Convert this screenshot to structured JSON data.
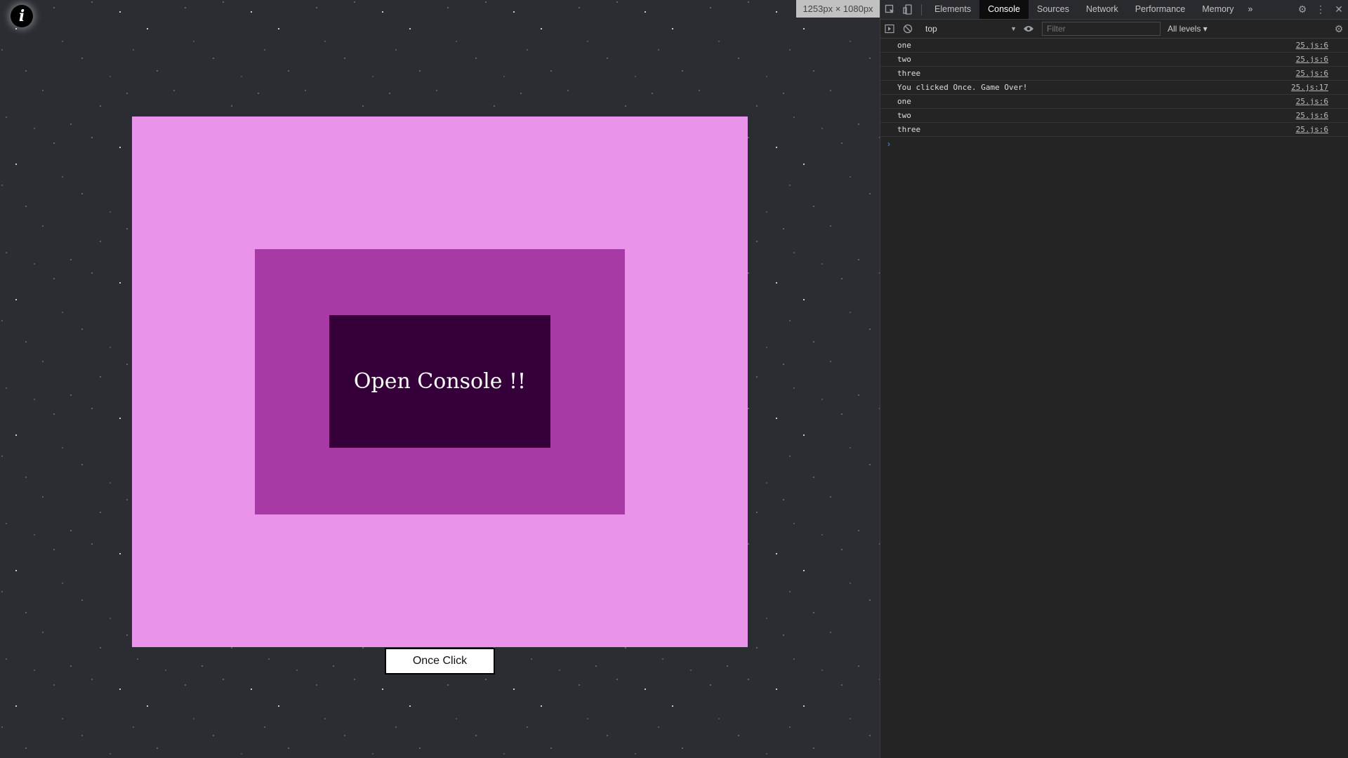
{
  "page": {
    "info_icon": "i",
    "size_badge": "1253px × 1080px",
    "heading": "Open Console !!",
    "button_label": "Once Click",
    "colors": {
      "outer": "#e994ea",
      "middle": "#a83aa5",
      "inner": "#35003a"
    }
  },
  "devtools": {
    "tabs": [
      {
        "label": "Elements",
        "active": false
      },
      {
        "label": "Console",
        "active": true
      },
      {
        "label": "Sources",
        "active": false
      },
      {
        "label": "Network",
        "active": false
      },
      {
        "label": "Performance",
        "active": false
      },
      {
        "label": "Memory",
        "active": false
      }
    ],
    "more_tabs": "»",
    "context": "top",
    "filter_placeholder": "Filter",
    "levels": "All levels ▾",
    "messages": [
      {
        "text": "one",
        "source": "25.js:6"
      },
      {
        "text": "two",
        "source": "25.js:6"
      },
      {
        "text": "three",
        "source": "25.js:6"
      },
      {
        "text": "You clicked Once. Game Over!",
        "source": "25.js:17"
      },
      {
        "text": "one",
        "source": "25.js:6"
      },
      {
        "text": "two",
        "source": "25.js:6"
      },
      {
        "text": "three",
        "source": "25.js:6"
      }
    ],
    "prompt": "›"
  }
}
